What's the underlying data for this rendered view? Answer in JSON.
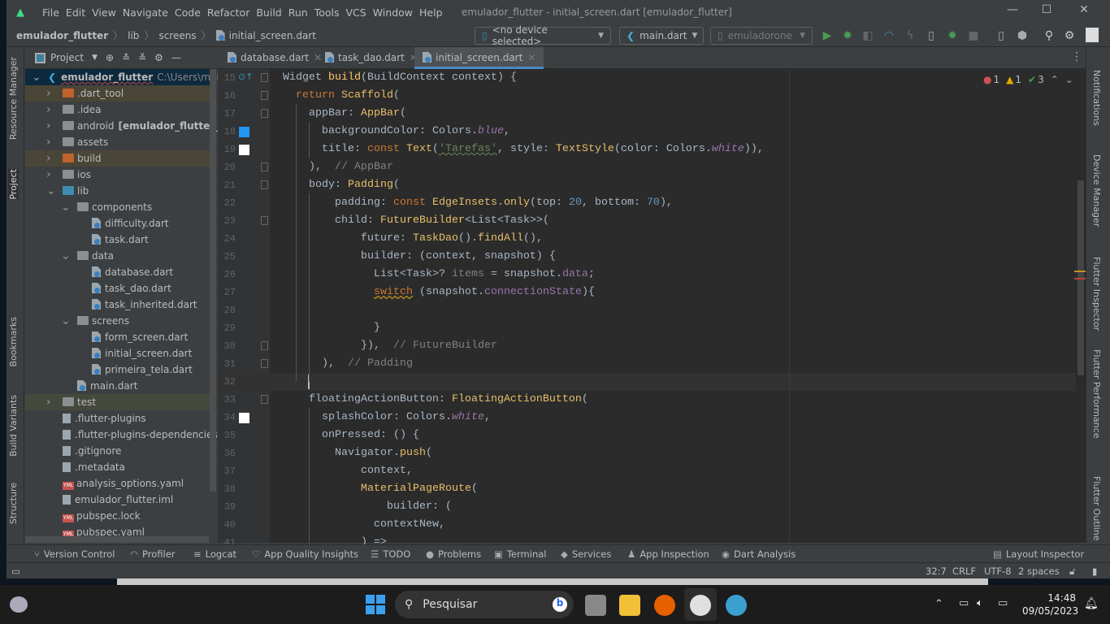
{
  "menu": [
    "File",
    "Edit",
    "View",
    "Navigate",
    "Code",
    "Refactor",
    "Build",
    "Run",
    "Tools",
    "VCS",
    "Window",
    "Help"
  ],
  "window_title": "emulador_flutter - initial_screen.dart [emulador_flutter]",
  "breadcrumb": [
    "emulador_flutter",
    "lib",
    "screens",
    "initial_screen.dart"
  ],
  "toolbar": {
    "device": "<no device selected>",
    "run_config": "main.dart",
    "emulator": "emuladorone"
  },
  "left_tool_tabs": [
    "Resource Manager",
    "Project",
    "Bookmarks",
    "Build Variants",
    "Structure"
  ],
  "right_tool_tabs": [
    "Notifications",
    "Device Manager",
    "Flutter Inspector",
    "Flutter Performance",
    "Flutter Outline"
  ],
  "project_panel": {
    "title": "Project"
  },
  "tree": [
    {
      "label": "emulador_flutter",
      "extra": "C:\\Users\\marlo\\St",
      "level": 0,
      "open": true,
      "icon": "flutter"
    },
    {
      "label": ".dart_tool",
      "level": 1,
      "icon": "folder-orange",
      "hl": true
    },
    {
      "label": ".idea",
      "level": 1,
      "icon": "folder-gear"
    },
    {
      "label": "android",
      "extra": "[emulador_flutter_andro",
      "level": 1,
      "icon": "folder-android"
    },
    {
      "label": "assets",
      "level": 1,
      "icon": "folder"
    },
    {
      "label": "build",
      "level": 1,
      "icon": "folder-orange",
      "hl": true
    },
    {
      "label": "ios",
      "level": 1,
      "icon": "folder-android"
    },
    {
      "label": "lib",
      "level": 1,
      "open": true,
      "icon": "folder-blue"
    },
    {
      "label": "components",
      "level": 2,
      "open": true,
      "icon": "folder"
    },
    {
      "label": "difficulty.dart",
      "level": 3,
      "icon": "dart"
    },
    {
      "label": "task.dart",
      "level": 3,
      "icon": "dart"
    },
    {
      "label": "data",
      "level": 2,
      "open": true,
      "icon": "folder"
    },
    {
      "label": "database.dart",
      "level": 3,
      "icon": "dart"
    },
    {
      "label": "task_dao.dart",
      "level": 3,
      "icon": "dart"
    },
    {
      "label": "task_inherited.dart",
      "level": 3,
      "icon": "dart"
    },
    {
      "label": "screens",
      "level": 2,
      "open": true,
      "icon": "folder"
    },
    {
      "label": "form_screen.dart",
      "level": 3,
      "icon": "dart"
    },
    {
      "label": "initial_screen.dart",
      "level": 3,
      "icon": "dart"
    },
    {
      "label": "primeira_tela.dart",
      "level": 3,
      "icon": "dart"
    },
    {
      "label": "main.dart",
      "level": 2,
      "icon": "dart",
      "leaf": true
    },
    {
      "label": "test",
      "level": 1,
      "icon": "folder-test",
      "hl2": true
    },
    {
      "label": ".flutter-plugins",
      "level": 1,
      "icon": "file",
      "leaf": true
    },
    {
      "label": ".flutter-plugins-dependencies",
      "level": 1,
      "icon": "file",
      "leaf": true
    },
    {
      "label": ".gitignore",
      "level": 1,
      "icon": "file",
      "leaf": true
    },
    {
      "label": ".metadata",
      "level": 1,
      "icon": "file",
      "leaf": true
    },
    {
      "label": "analysis_options.yaml",
      "level": 1,
      "icon": "yml",
      "leaf": true
    },
    {
      "label": "emulador_flutter.iml",
      "level": 1,
      "icon": "file",
      "leaf": true
    },
    {
      "label": "pubspec.lock",
      "level": 1,
      "icon": "yml",
      "leaf": true
    },
    {
      "label": "pubspec.yaml",
      "level": 1,
      "icon": "yml",
      "leaf": true
    }
  ],
  "tabs": [
    "database.dart",
    "task_dao.dart",
    "initial_screen.dart"
  ],
  "active_tab": 2,
  "inspections": {
    "errors": "1",
    "warnings": "1",
    "typos": "3"
  },
  "code": [
    {
      "n": "15",
      "t": [
        [
          "  Widget ",
          ""
        ],
        [
          "build",
          "f"
        ],
        [
          "(BuildContext context) {",
          ""
        ]
      ]
    },
    {
      "n": "16",
      "t": [
        [
          "    ",
          ""
        ],
        [
          "return ",
          "k"
        ],
        [
          "Scaffold",
          "c"
        ],
        [
          "(",
          ""
        ]
      ]
    },
    {
      "n": "17",
      "t": [
        [
          "      appBar: ",
          ""
        ],
        [
          "AppBar",
          "c"
        ],
        [
          "(",
          ""
        ]
      ]
    },
    {
      "n": "18",
      "t": [
        [
          "        backgroundColor: Colors.",
          ""
        ],
        [
          "blue",
          "p"
        ],
        [
          ",",
          ""
        ]
      ],
      "swatch": "#2196f3"
    },
    {
      "n": "19",
      "t": [
        [
          "        title: ",
          ""
        ],
        [
          "const ",
          "k"
        ],
        [
          "Text",
          "c"
        ],
        [
          "(",
          ""
        ],
        [
          "'Tarefas'",
          "s wavy"
        ],
        [
          ", style: ",
          ""
        ],
        [
          "TextStyle",
          "c"
        ],
        [
          "(color: Colors.",
          ""
        ],
        [
          "white",
          "p"
        ],
        [
          ")),",
          ""
        ]
      ],
      "swatch": "#ffffff"
    },
    {
      "n": "20",
      "t": [
        [
          "      ),  ",
          ""
        ],
        [
          "// AppBar",
          "m"
        ]
      ]
    },
    {
      "n": "21",
      "t": [
        [
          "      body: ",
          ""
        ],
        [
          "Padding",
          "c"
        ],
        [
          "(",
          ""
        ]
      ]
    },
    {
      "n": "22",
      "t": [
        [
          "          padding: ",
          ""
        ],
        [
          "const ",
          "k"
        ],
        [
          "EdgeInsets",
          "c"
        ],
        [
          ".",
          ""
        ],
        [
          "only",
          "c"
        ],
        [
          "(top: ",
          ""
        ],
        [
          "20",
          "n"
        ],
        [
          ", bottom: ",
          ""
        ],
        [
          "70",
          "n"
        ],
        [
          "),",
          ""
        ]
      ]
    },
    {
      "n": "23",
      "t": [
        [
          "          child: ",
          ""
        ],
        [
          "FutureBuilder",
          "c"
        ],
        [
          "<List<Task>>(",
          ""
        ]
      ]
    },
    {
      "n": "24",
      "t": [
        [
          "              future: ",
          ""
        ],
        [
          "TaskDao",
          "c"
        ],
        [
          "().",
          ""
        ],
        [
          "findAll",
          "c"
        ],
        [
          "(),",
          ""
        ]
      ]
    },
    {
      "n": "25",
      "t": [
        [
          "              builder: (context, snapshot) {",
          ""
        ]
      ]
    },
    {
      "n": "26",
      "t": [
        [
          "                List<Task>? ",
          ""
        ],
        [
          "items",
          "m"
        ],
        [
          " = snapshot.",
          ""
        ],
        [
          "data",
          "pv"
        ],
        [
          ";",
          ""
        ]
      ]
    },
    {
      "n": "27",
      "t": [
        [
          "                ",
          ""
        ],
        [
          "switch",
          "k wavyy"
        ],
        [
          " (snapshot.",
          ""
        ],
        [
          "connectionState",
          "pv"
        ],
        [
          "){",
          ""
        ]
      ]
    },
    {
      "n": "28",
      "t": []
    },
    {
      "n": "29",
      "t": [
        [
          "                }",
          ""
        ]
      ]
    },
    {
      "n": "30",
      "t": [
        [
          "              }),  ",
          ""
        ],
        [
          "// FutureBuilder",
          "m"
        ]
      ]
    },
    {
      "n": "31",
      "t": [
        [
          "        ),  ",
          ""
        ],
        [
          "// Padding",
          "m"
        ]
      ]
    },
    {
      "n": "32",
      "t": [
        [
          "      ",
          ""
        ]
      ]
    },
    {
      "n": "33",
      "t": [
        [
          "      floatingActionButton: ",
          ""
        ],
        [
          "FloatingActionButton",
          "c"
        ],
        [
          "(",
          ""
        ]
      ]
    },
    {
      "n": "34",
      "t": [
        [
          "        splashColor: Colors.",
          ""
        ],
        [
          "white",
          "p"
        ],
        [
          ",",
          ""
        ]
      ],
      "swatch": "#ffffff"
    },
    {
      "n": "35",
      "t": [
        [
          "        onPressed: () {",
          ""
        ]
      ]
    },
    {
      "n": "36",
      "t": [
        [
          "          Navigator.",
          ""
        ],
        [
          "push",
          "c"
        ],
        [
          "(",
          ""
        ]
      ]
    },
    {
      "n": "37",
      "t": [
        [
          "              context,",
          ""
        ]
      ]
    },
    {
      "n": "38",
      "t": [
        [
          "              ",
          ""
        ],
        [
          "MaterialPageRoute",
          "c"
        ],
        [
          "(",
          ""
        ]
      ]
    },
    {
      "n": "39",
      "t": [
        [
          "                  builder: (",
          ""
        ]
      ]
    },
    {
      "n": "40",
      "t": [
        [
          "                contextNew,",
          ""
        ]
      ]
    },
    {
      "n": "41",
      "t": [
        [
          "              ) =>",
          ""
        ]
      ]
    }
  ],
  "bottom_tools": [
    "Version Control",
    "Profiler",
    "Logcat",
    "App Quality Insights",
    "TODO",
    "Problems",
    "Terminal",
    "Services",
    "App Inspection",
    "Dart Analysis",
    "Layout Inspector"
  ],
  "status": {
    "position": "32:7",
    "line_sep": "CRLF",
    "encoding": "UTF-8",
    "indent": "2 spaces"
  },
  "taskbar": {
    "search_placeholder": "Pesquisar",
    "time": "14:48",
    "date": "09/05/2023"
  },
  "colors": {
    "accent": "#4a88c7",
    "editor_bg": "#2b2b2b",
    "panel_bg": "#3c3f41"
  }
}
